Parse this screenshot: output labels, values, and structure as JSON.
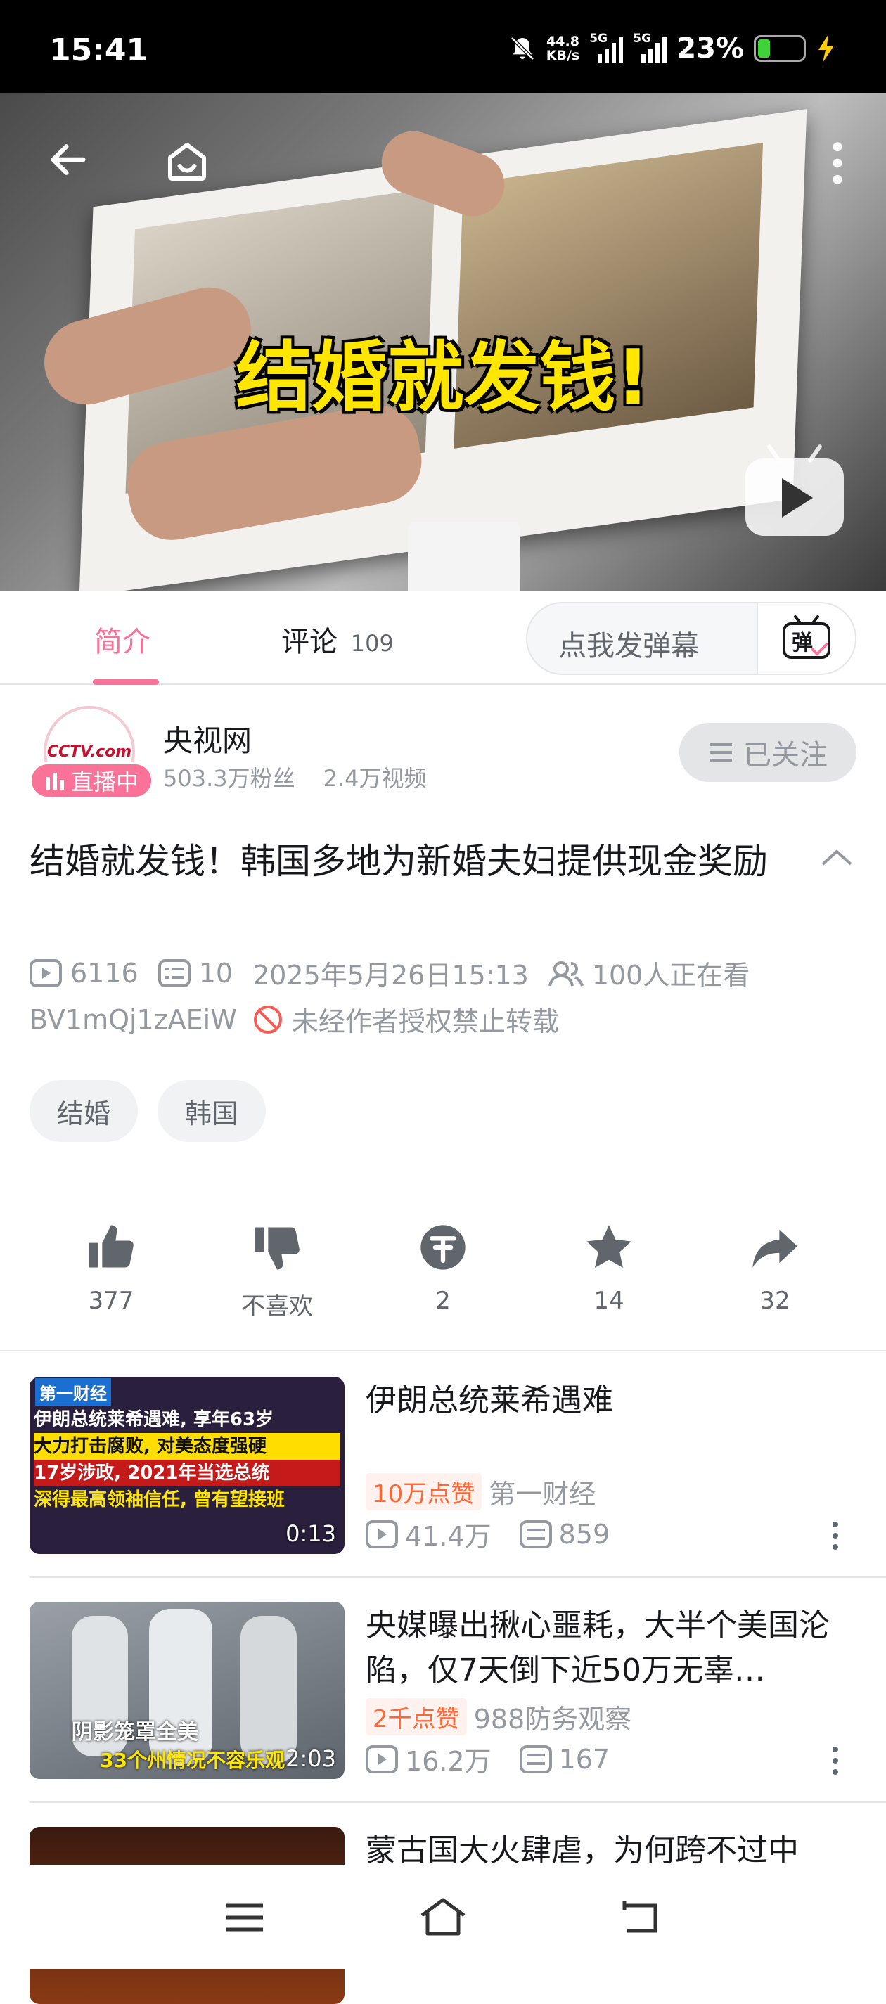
{
  "status_bar": {
    "time": "15:41",
    "net_speed_value": "44.8",
    "net_speed_unit": "KB/s",
    "signal1": "5G",
    "signal2": "5G",
    "battery": "23%"
  },
  "video": {
    "caption": "结婚就发钱!"
  },
  "tabs": {
    "intro": "简介",
    "comments": "评论",
    "comments_count": "109",
    "danmaku_placeholder": "点我发弹幕",
    "danmaku_icon_label": "弹"
  },
  "author": {
    "name": "央视网",
    "fans": "503.3万粉丝",
    "videos": "2.4万视频",
    "live_badge": "直播中",
    "follow_label": "已关注",
    "avatar_text": "CCTV.com"
  },
  "video_info": {
    "title": "结婚就发钱！韩国多地为新婚夫妇提供现金奖励",
    "plays": "6116",
    "danmaku": "10",
    "date": "2025年5月26日15:13",
    "watching": "100人正在看",
    "bvid": "BV1mQj1zAEiW",
    "copyright": "未经作者授权禁止转载"
  },
  "tags": [
    "结婚",
    "韩国"
  ],
  "actions": {
    "like": "377",
    "dislike": "不喜欢",
    "coin": "2",
    "favorite": "14",
    "share": "32"
  },
  "recommendations": [
    {
      "title": "伊朗总统莱希遇难",
      "badge": "10万点赞",
      "uploader": "第一财经",
      "plays": "41.4万",
      "danmaku": "859",
      "duration": "0:13",
      "thumb_logo": "第一财经",
      "thumb_lines": [
        "伊朗总统莱希遇难, 享年63岁",
        "大力打击腐败, 对美态度强硬",
        "17岁涉政, 2021年当选总统",
        "深得最高领袖信任, 曾有望接班"
      ]
    },
    {
      "title": "央媒曝出揪心噩耗，大半个美国沦陷，仅7天倒下近50万无辜…",
      "badge": "2千点赞",
      "uploader": "988防务观察",
      "plays": "16.2万",
      "danmaku": "167",
      "duration": "2:03",
      "thumb_line1": "阴影笼罩全美",
      "thumb_line2": "33个州情况不容乐观"
    },
    {
      "title": "蒙古国大火肆虐，为何跨不过中"
    }
  ],
  "colors": {
    "accent": "#fb7299",
    "text_secondary": "#9499a0",
    "hot_badge": "#ff6633"
  }
}
